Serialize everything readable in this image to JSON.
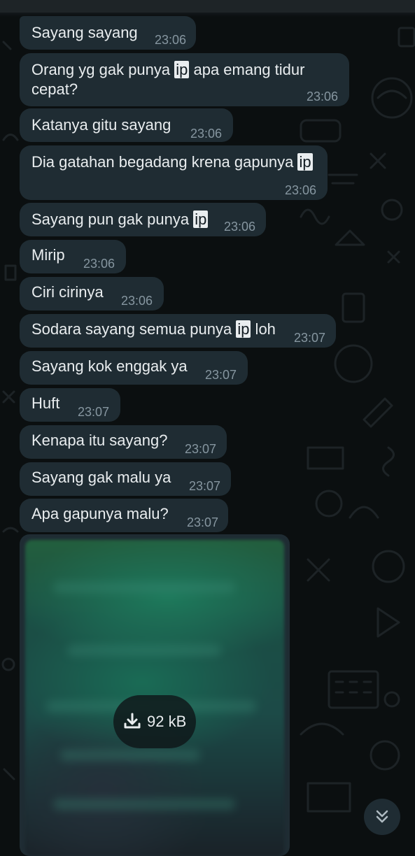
{
  "messages": [
    {
      "text_before": "Sayang sayang",
      "highlight": "",
      "text_after": "",
      "time": "23:06"
    },
    {
      "text_before": "Orang yg gak punya ",
      "highlight": "ip",
      "text_after": " apa emang tidur",
      "line2": "cepat?",
      "time": "23:06"
    },
    {
      "text_before": "Katanya gitu sayang",
      "highlight": "",
      "text_after": "",
      "time": "23:06"
    },
    {
      "text_before": "Dia gatahan begadang krena gapunya ",
      "highlight": "ip",
      "text_after": "",
      "time": "23:06"
    },
    {
      "text_before": "Sayang pun gak punya ",
      "highlight": "ip",
      "text_after": "",
      "time": "23:06"
    },
    {
      "text_before": "Mirip",
      "highlight": "",
      "text_after": "",
      "time": "23:06"
    },
    {
      "text_before": "Ciri cirinya",
      "highlight": "",
      "text_after": "",
      "time": "23:06"
    },
    {
      "text_before": "Sodara sayang semua punya ",
      "highlight": "ip",
      "text_after": " loh",
      "time": "23:07"
    },
    {
      "text_before": "Sayang kok enggak ya",
      "highlight": "",
      "text_after": "",
      "time": "23:07"
    },
    {
      "text_before": "Huft",
      "highlight": "",
      "text_after": "",
      "time": "23:07"
    },
    {
      "text_before": "Kenapa itu sayang?",
      "highlight": "",
      "text_after": "",
      "time": "23:07"
    },
    {
      "text_before": "Sayang gak malu ya",
      "highlight": "",
      "text_after": "",
      "time": "23:07"
    },
    {
      "text_before": "Apa gapunya malu?",
      "highlight": "",
      "text_after": "",
      "time": "23:07"
    }
  ],
  "image_message": {
    "download_size": "92 kB",
    "download_icon": "download-icon"
  },
  "scroll_button": {
    "icon": "double-chevron-down-icon"
  },
  "colors": {
    "bubble": "#1f2c33",
    "text": "#e9edef",
    "timestamp": "#8696a0",
    "background": "#0b0f10"
  }
}
